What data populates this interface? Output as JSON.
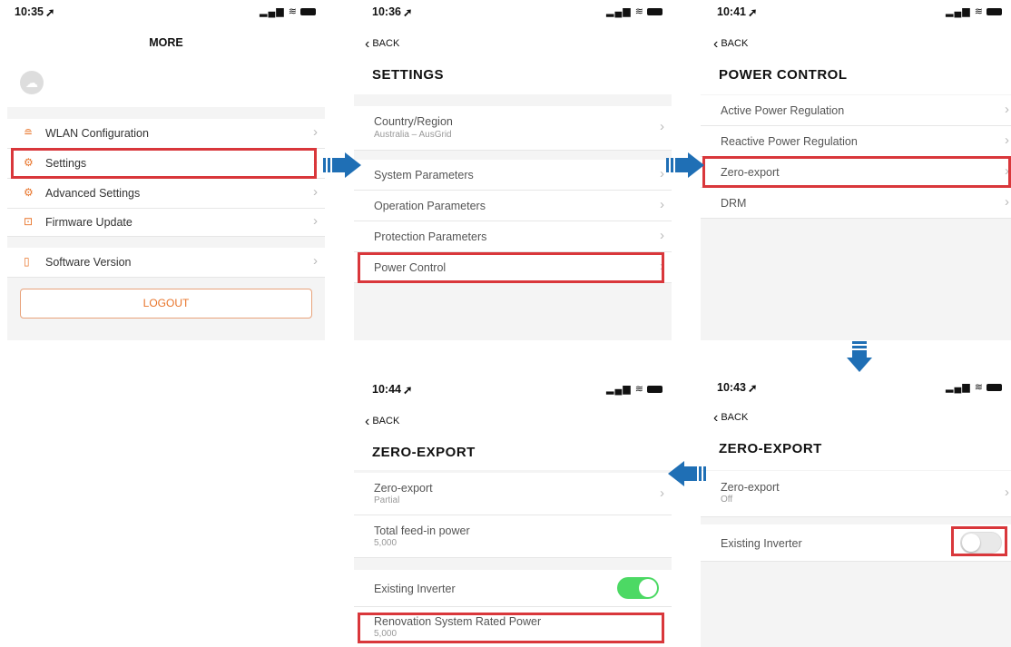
{
  "screens": {
    "more": {
      "time": "10:35",
      "title": "MORE",
      "items": [
        {
          "label": "WLAN Configuration",
          "icon": "router-icon"
        },
        {
          "label": "Settings",
          "icon": "gear-icon"
        },
        {
          "label": "Advanced Settings",
          "icon": "advanced-gear-icon"
        },
        {
          "label": "Firmware Update",
          "icon": "firmware-icon"
        },
        {
          "label": "Software Version",
          "icon": "version-icon"
        }
      ],
      "logout": "LOGOUT"
    },
    "settings": {
      "time": "10:36",
      "back": "BACK",
      "title": "SETTINGS",
      "country": {
        "label": "Country/Region",
        "value": "Australia – AusGrid"
      },
      "items": [
        {
          "label": "System Parameters"
        },
        {
          "label": "Operation Parameters"
        },
        {
          "label": "Protection Parameters"
        },
        {
          "label": "Power Control"
        }
      ]
    },
    "power_control": {
      "time": "10:41",
      "back": "BACK",
      "title": "POWER CONTROL",
      "items": [
        {
          "label": "Active Power Regulation"
        },
        {
          "label": "Reactive Power Regulation"
        },
        {
          "label": "Zero-export"
        },
        {
          "label": "DRM"
        }
      ]
    },
    "zero_export_off": {
      "time": "10:43",
      "back": "BACK",
      "title": "ZERO-EXPORT",
      "zero_export": {
        "label": "Zero-export",
        "value": "Off"
      },
      "existing_inverter": {
        "label": "Existing Inverter",
        "on": false
      }
    },
    "zero_export_partial": {
      "time": "10:44",
      "back": "BACK",
      "title": "ZERO-EXPORT",
      "zero_export": {
        "label": "Zero-export",
        "value": "Partial"
      },
      "total_feed_in": {
        "label": "Total feed-in power",
        "value": "5,000"
      },
      "existing_inverter": {
        "label": "Existing Inverter",
        "on": true
      },
      "renovation": {
        "label": "Renovation System Rated Power",
        "value": "5,000"
      }
    }
  },
  "colors": {
    "highlight": "#d9373b",
    "accent": "#e8742a",
    "toggle_on": "#4cd964",
    "arrow": "#1f6fb5"
  }
}
